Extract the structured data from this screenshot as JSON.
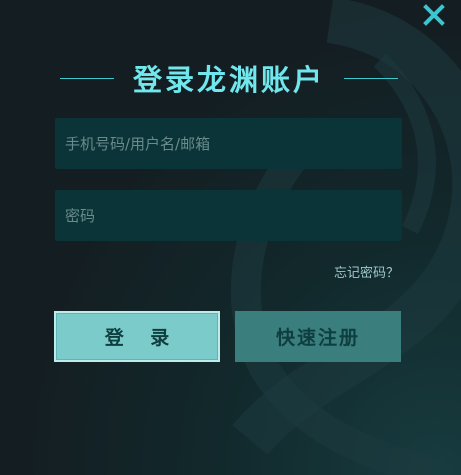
{
  "dialog": {
    "title": "登录龙渊账户",
    "close_icon": "close-icon",
    "accent_color": "#6fe7ec"
  },
  "form": {
    "username_placeholder": "手机号码/用户名/邮箱",
    "username_value": "",
    "password_placeholder": "密码",
    "password_value": "",
    "forgot_label": "忘记密码？"
  },
  "actions": {
    "login_label": "登 录",
    "register_label": "快速注册"
  }
}
